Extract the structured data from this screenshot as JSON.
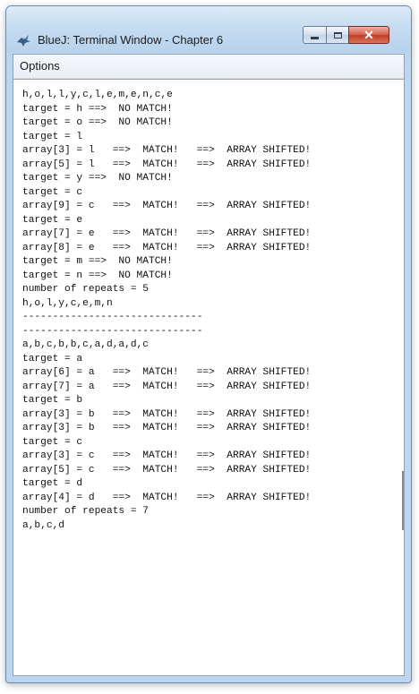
{
  "window": {
    "title": "BlueJ: Terminal Window - Chapter 6",
    "icon": "bluej-bird-icon",
    "controls": {
      "minimize": "minimize-icon",
      "maximize": "maximize-icon",
      "close_label": "✕"
    }
  },
  "menubar": {
    "options_label": "Options"
  },
  "terminal": {
    "lines": [
      "h,o,l,l,y,c,l,e,m,e,n,c,e",
      "target = h ==>  NO MATCH!",
      "target = o ==>  NO MATCH!",
      "target = l",
      "array[3] = l   ==>  MATCH!   ==>  ARRAY SHIFTED!",
      "array[5] = l   ==>  MATCH!   ==>  ARRAY SHIFTED!",
      "target = y ==>  NO MATCH!",
      "target = c",
      "array[9] = c   ==>  MATCH!   ==>  ARRAY SHIFTED!",
      "target = e",
      "array[7] = e   ==>  MATCH!   ==>  ARRAY SHIFTED!",
      "array[8] = e   ==>  MATCH!   ==>  ARRAY SHIFTED!",
      "target = m ==>  NO MATCH!",
      "target = n ==>  NO MATCH!",
      "number of repeats = 5",
      "h,o,l,y,c,e,m,n",
      "------------------------------",
      "------------------------------",
      "a,b,c,b,b,c,a,d,a,d,c",
      "target = a",
      "array[6] = a   ==>  MATCH!   ==>  ARRAY SHIFTED!",
      "array[7] = a   ==>  MATCH!   ==>  ARRAY SHIFTED!",
      "target = b",
      "array[3] = b   ==>  MATCH!   ==>  ARRAY SHIFTED!",
      "array[3] = b   ==>  MATCH!   ==>  ARRAY SHIFTED!",
      "target = c",
      "array[3] = c   ==>  MATCH!   ==>  ARRAY SHIFTED!",
      "array[5] = c   ==>  MATCH!   ==>  ARRAY SHIFTED!",
      "target = d",
      "array[4] = d   ==>  MATCH!   ==>  ARRAY SHIFTED!",
      "number of repeats = 7",
      "a,b,c,d"
    ]
  }
}
